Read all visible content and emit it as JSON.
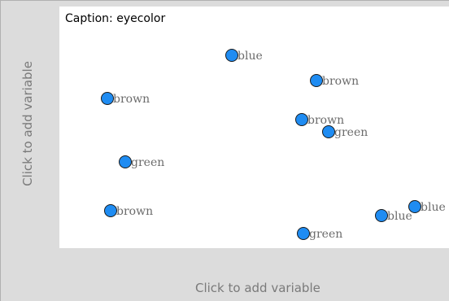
{
  "caption": "Caption: eyecolor",
  "y_axis": {
    "placeholder": "Click to add variable"
  },
  "x_axis": {
    "placeholder": "Click to add variable"
  },
  "points": [
    {
      "label": "blue"
    },
    {
      "label": "brown"
    },
    {
      "label": "brown"
    },
    {
      "label": "brown"
    },
    {
      "label": "green"
    },
    {
      "label": "green"
    },
    {
      "label": "brown"
    },
    {
      "label": "blue"
    },
    {
      "label": "blue"
    },
    {
      "label": "green"
    }
  ],
  "colors": {
    "dot_fill": "#1f8cf2",
    "label_text": "#6b6b6b",
    "axis_placeholder_text": "#7a7a7a",
    "plot_background": "#ffffff",
    "frame_background": "#dcdcdc"
  }
}
